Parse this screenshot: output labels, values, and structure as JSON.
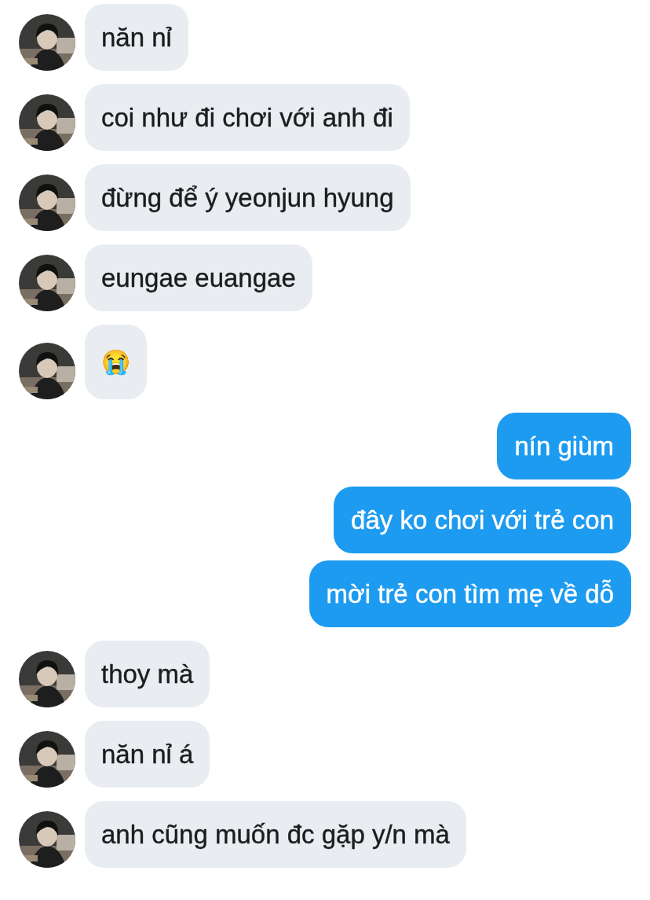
{
  "messages": [
    {
      "kind": "incoming",
      "text": "năn nỉ"
    },
    {
      "kind": "incoming",
      "text": "coi như đi chơi với anh đi"
    },
    {
      "kind": "incoming",
      "text": "đừng để ý yeonjun hyung"
    },
    {
      "kind": "incoming",
      "text": "eungae euangae"
    },
    {
      "kind": "incoming",
      "text": "😭"
    },
    {
      "kind": "outgoing",
      "text": "nín giùm"
    },
    {
      "kind": "outgoing",
      "text": "đây ko chơi với trẻ con"
    },
    {
      "kind": "outgoing",
      "text": "mời trẻ con tìm mẹ về dỗ"
    },
    {
      "kind": "incoming",
      "text": "thoy mà"
    },
    {
      "kind": "incoming",
      "text": "năn nỉ á"
    },
    {
      "kind": "incoming",
      "text": "anh cũng muốn đc gặp y/n mà"
    }
  ]
}
